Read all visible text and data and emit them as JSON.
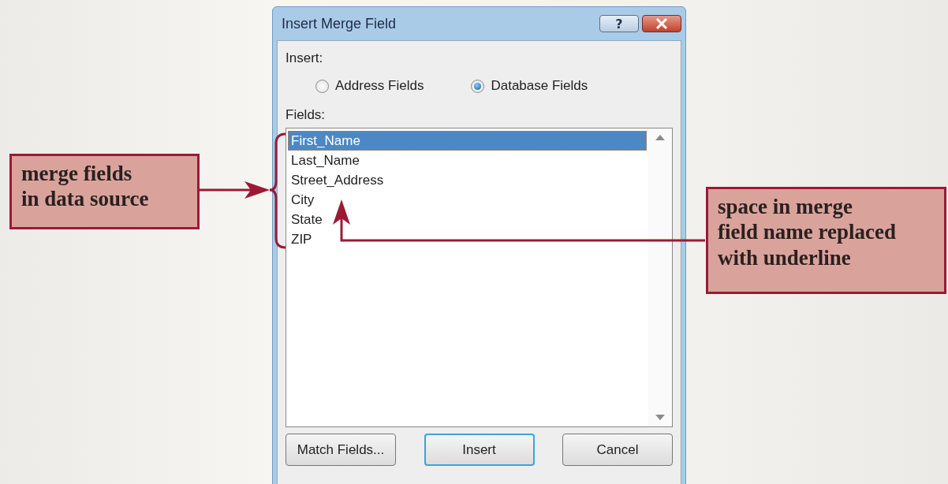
{
  "dialog": {
    "title": "Insert Merge Field",
    "help_button": "?",
    "insert_label": "Insert:",
    "insert_options": [
      {
        "label": "Address Fields",
        "selected": false
      },
      {
        "label": "Database Fields",
        "selected": true
      }
    ],
    "fields_label": "Fields:",
    "fields": [
      {
        "label": "First_Name",
        "selected": true
      },
      {
        "label": "Last_Name",
        "selected": false
      },
      {
        "label": "Street_Address",
        "selected": false
      },
      {
        "label": "City",
        "selected": false
      },
      {
        "label": "State",
        "selected": false
      },
      {
        "label": "ZIP",
        "selected": false
      }
    ],
    "buttons": [
      {
        "label": "Match Fields...",
        "default": false
      },
      {
        "label": "Insert",
        "default": true
      },
      {
        "label": "Cancel",
        "default": false
      }
    ]
  },
  "callouts": [
    {
      "lines": [
        "merge fields",
        "in data source"
      ]
    },
    {
      "lines": [
        "space in merge",
        "field name replaced",
        "with underline"
      ]
    }
  ]
}
